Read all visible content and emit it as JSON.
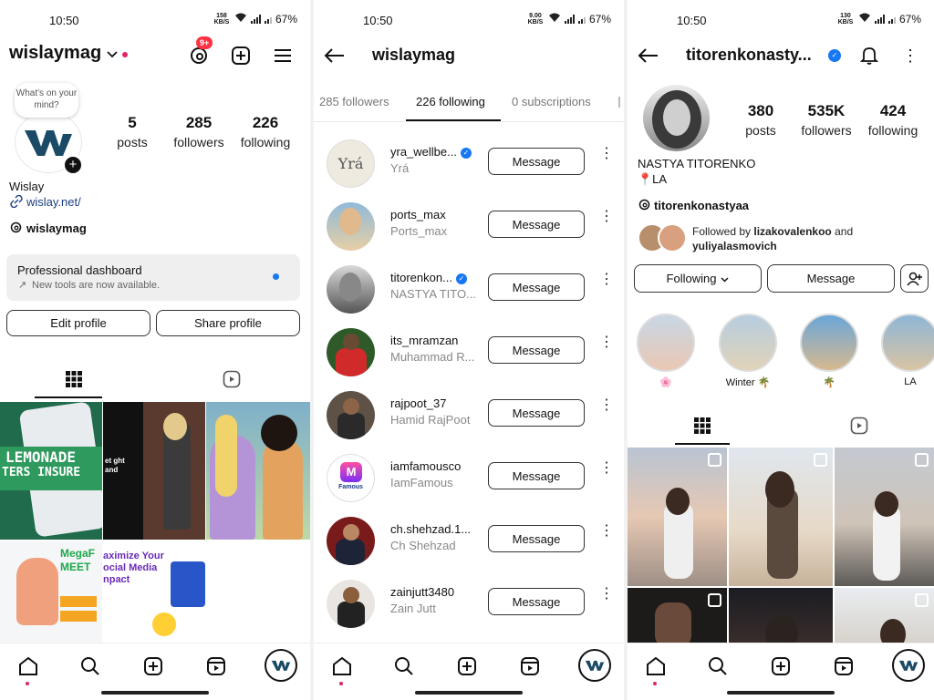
{
  "status": {
    "time": "10:50",
    "battery": "67%",
    "net_p1": "158 KB/S",
    "net_p2": "9.00 KB/S",
    "net_p3": "130 KB/S"
  },
  "profile": {
    "username": "wislaymag",
    "notif_badge": "9+",
    "note_bubble": "What's on your mind?",
    "posts_count": "5",
    "posts_label": "posts",
    "followers_count": "285",
    "followers_label": "followers",
    "following_count": "226",
    "following_label": "following",
    "display_name": "Wislay",
    "link": "wislay.net/",
    "threads_handle": "wislaymag",
    "dashboard_title": "Professional dashboard",
    "dashboard_sub": "New tools are now available.",
    "edit_button": "Edit profile",
    "share_button": "Share profile",
    "tile1_text1": "LEMONADE",
    "tile1_text2": "TERS INSURE",
    "tile2_text": "et ght and",
    "tile5_text": "aximize Your ocial Media npact",
    "tile4_text": "MegaF MEET"
  },
  "following_list": {
    "title": "wislaymag",
    "tab_followers": "285 followers",
    "tab_following": "226 following",
    "tab_subscriptions": "0 subscriptions",
    "message_label": "Message",
    "rows": [
      {
        "username": "yra_wellbe...",
        "fullname": "Yrá",
        "verified": true
      },
      {
        "username": "ports_max",
        "fullname": "Ports_max",
        "verified": false
      },
      {
        "username": "titorenkon...",
        "fullname": "NASTYA TITO...",
        "verified": true
      },
      {
        "username": "its_mramzan",
        "fullname": "Muhammad R...",
        "verified": false
      },
      {
        "username": "rajpoot_37",
        "fullname": "Hamid RajPoot",
        "verified": false
      },
      {
        "username": "iamfamousco",
        "fullname": "IamFamous",
        "verified": false
      },
      {
        "username": "ch.shehzad.1...",
        "fullname": "Ch Shehzad",
        "verified": false
      },
      {
        "username": "zainjutt3480",
        "fullname": "Zain Jutt",
        "verified": false
      }
    ],
    "row0_logo": "Yrá",
    "row5_logo": "Famous"
  },
  "other_profile": {
    "username": "titorenkonasty...",
    "posts_count": "380",
    "posts_label": "posts",
    "followers_count": "535K",
    "followers_label": "followers",
    "following_count": "424",
    "following_label": "following",
    "display_name": "NASTYA TITORENKO",
    "location": "📍LA",
    "threads_handle": "titorenkonastyaa",
    "followed_by_prefix": "Followed by",
    "followed_by_1": "lizakovalenkoo",
    "followed_by_and": "and",
    "followed_by_2": "yuliyalasmovich",
    "following_button": "Following",
    "message_button": "Message",
    "highlights": [
      "🌸",
      "Winter 🌴",
      "🌴",
      "LA"
    ]
  },
  "colors": {
    "accent_blue": "#1877f2",
    "link_blue": "#1c3f82",
    "badge_red": "#e0245e",
    "wislay_logo": "#1a4a66"
  }
}
